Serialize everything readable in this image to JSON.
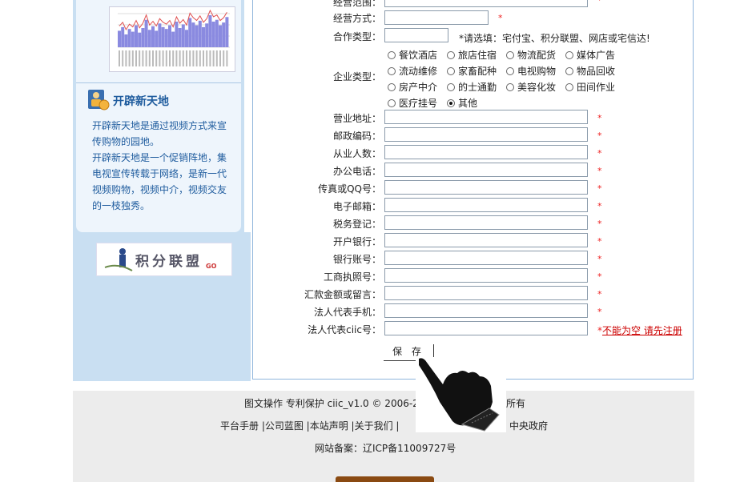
{
  "sidebar": {
    "section_title": "开辟新天地",
    "section_icon": "person-icon",
    "section_text_1": "开辟新天地是通过视频方式来宣传购物的园地。",
    "section_text_2": "开辟新天地是一个促销阵地，集电视宣传转载于网络，是新一代视频购物，视频中介，视频交友的一枝独秀。",
    "banner_text": "积分联盟",
    "banner_go": "GO",
    "chart_bars": [
      18,
      22,
      14,
      20,
      17,
      24,
      16,
      21,
      30,
      19,
      23,
      18,
      26,
      22,
      20,
      24,
      17,
      28,
      21,
      25,
      19,
      32,
      27,
      24,
      29,
      22,
      26,
      35,
      28,
      30,
      24,
      27,
      33
    ]
  },
  "form": {
    "row_scope_label": "经营范围：",
    "row_mode_label": "经营方式：",
    "row_coop_label": "合作类型：",
    "row_coop_hint": "*请选填：宅付宝、积分联盟、网店或宅信达!",
    "row_type_label": "企业类型：",
    "types": [
      "餐饮酒店",
      "旅店住宿",
      "物流配货",
      "媒体广告",
      "流动维修",
      "家畜配种",
      "电视购物",
      "物品回收",
      "房产中介",
      "的士通勤",
      "美容化妆",
      "田间作业",
      "医疗挂号",
      "其他"
    ],
    "type_selected": "其他",
    "fields": [
      {
        "label": "营业地址：",
        "required": "*"
      },
      {
        "label": "邮政编码：",
        "required": "*"
      },
      {
        "label": "从业人数：",
        "required": "*"
      },
      {
        "label": "办公电话：",
        "required": "*"
      },
      {
        "label": "传真或QQ号：",
        "required": "*"
      },
      {
        "label": "电子邮箱：",
        "required": "*"
      },
      {
        "label": "税务登记：",
        "required": "*"
      },
      {
        "label": "开户银行：",
        "required": "*"
      },
      {
        "label": "银行账号：",
        "required": "*"
      },
      {
        "label": "工商执照号：",
        "required": "*"
      },
      {
        "label": "汇款金额或留言：",
        "required": "*"
      },
      {
        "label": "法人代表手机：",
        "required": "*"
      },
      {
        "label": "法人代表ciic号：",
        "required": "*"
      }
    ],
    "ciic_error_prefix": "*",
    "ciic_error": "不能为空 请先注册",
    "save_label": "保 存",
    "required_mark": "*"
  },
  "footer": {
    "line1_left": "图文操作  专利保护   ciic_v1.0 © 2006-2",
    "line1_right": "所有",
    "line2_left": "平台手册 |公司蓝图 |本站声明 |关于我们 |",
    "line2_right": "中央政府",
    "line3": "网站备案：辽ICP备11009727号"
  },
  "cursor": {
    "icon": "hand-pointer-icon"
  },
  "colors": {
    "sidebar_bg": "#c9dff2",
    "accent_text": "#1f5c9e",
    "required": "#e22",
    "error_link": "#cc0000"
  }
}
